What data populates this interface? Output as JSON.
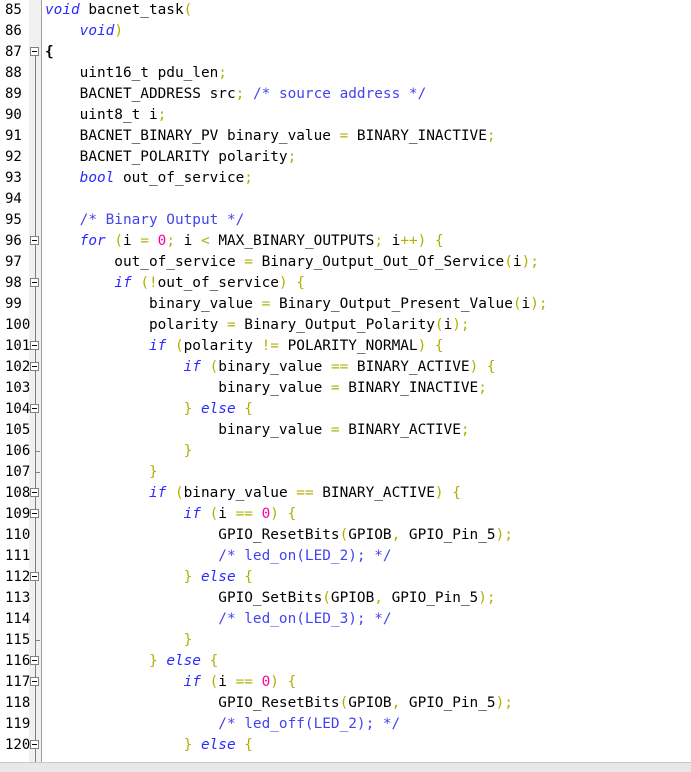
{
  "editor": {
    "lines": [
      {
        "n": "85",
        "fold": "",
        "html": "<span class='kw'>void</span> bacnet_task<span class='op'>(</span>"
      },
      {
        "n": "86",
        "fold": "",
        "html": "    <span class='kw'>void</span><span class='op'>)</span>"
      },
      {
        "n": "87",
        "fold": "box",
        "html": "<span class='br' style='color:#000;font-weight:bold'>{</span>"
      },
      {
        "n": "88",
        "fold": "",
        "html": "    uint16_t pdu_len<span class='op'>;</span>"
      },
      {
        "n": "89",
        "fold": "",
        "html": "    BACNET_ADDRESS src<span class='op'>;</span> <span class='cm'>/* source address */</span>"
      },
      {
        "n": "90",
        "fold": "",
        "html": "    uint8_t i<span class='op'>;</span>"
      },
      {
        "n": "91",
        "fold": "",
        "html": "    BACNET_BINARY_PV binary_value <span class='op'>=</span> BINARY_INACTIVE<span class='op'>;</span>"
      },
      {
        "n": "92",
        "fold": "",
        "html": "    BACNET_POLARITY polarity<span class='op'>;</span>"
      },
      {
        "n": "93",
        "fold": "",
        "html": "    <span class='kw'>bool</span> out_of_service<span class='op'>;</span>"
      },
      {
        "n": "94",
        "fold": "",
        "html": ""
      },
      {
        "n": "95",
        "fold": "",
        "html": "    <span class='cm'>/* Binary Output */</span>"
      },
      {
        "n": "96",
        "fold": "box",
        "html": "    <span class='kw'>for</span> <span class='op'>(</span>i <span class='op'>=</span> <span class='num'>0</span><span class='op'>;</span> i <span class='op'>&lt;</span> MAX_BINARY_OUTPUTS<span class='op'>;</span> i<span class='op'>++)</span> <span class='op'>{</span>"
      },
      {
        "n": "97",
        "fold": "",
        "html": "        out_of_service <span class='op'>=</span> Binary_Output_Out_Of_Service<span class='op'>(</span>i<span class='op'>);</span>"
      },
      {
        "n": "98",
        "fold": "box",
        "html": "        <span class='kw'>if</span> <span class='op'>(!</span>out_of_service<span class='op'>)</span> <span class='op'>{</span>"
      },
      {
        "n": "99",
        "fold": "",
        "html": "            binary_value <span class='op'>=</span> Binary_Output_Present_Value<span class='op'>(</span>i<span class='op'>);</span>"
      },
      {
        "n": "100",
        "fold": "",
        "html": "            polarity <span class='op'>=</span> Binary_Output_Polarity<span class='op'>(</span>i<span class='op'>);</span>"
      },
      {
        "n": "101",
        "fold": "box",
        "html": "            <span class='kw'>if</span> <span class='op'>(</span>polarity <span class='op'>!=</span> POLARITY_NORMAL<span class='op'>)</span> <span class='op'>{</span>"
      },
      {
        "n": "102",
        "fold": "box",
        "html": "                <span class='kw'>if</span> <span class='op'>(</span>binary_value <span class='op'>==</span> BINARY_ACTIVE<span class='op'>)</span> <span class='op'>{</span>"
      },
      {
        "n": "103",
        "fold": "",
        "html": "                    binary_value <span class='op'>=</span> BINARY_INACTIVE<span class='op'>;</span>"
      },
      {
        "n": "104",
        "fold": "box",
        "html": "                <span class='op'>}</span> <span class='kw'>else</span> <span class='op'>{</span>"
      },
      {
        "n": "105",
        "fold": "",
        "html": "                    binary_value <span class='op'>=</span> BINARY_ACTIVE<span class='op'>;</span>"
      },
      {
        "n": "106",
        "fold": "end",
        "html": "                <span class='op'>}</span>"
      },
      {
        "n": "107",
        "fold": "end",
        "html": "            <span class='op'>}</span>"
      },
      {
        "n": "108",
        "fold": "box",
        "html": "            <span class='kw'>if</span> <span class='op'>(</span>binary_value <span class='op'>==</span> BINARY_ACTIVE<span class='op'>)</span> <span class='op'>{</span>"
      },
      {
        "n": "109",
        "fold": "box",
        "html": "                <span class='kw'>if</span> <span class='op'>(</span>i <span class='op'>==</span> <span class='num'>0</span><span class='op'>)</span> <span class='op'>{</span>"
      },
      {
        "n": "110",
        "fold": "",
        "html": "                    GPIO_ResetBits<span class='op'>(</span>GPIOB<span class='op'>,</span> GPIO_Pin_5<span class='op'>);</span>"
      },
      {
        "n": "111",
        "fold": "",
        "html": "                    <span class='cm'>/* led_on(LED_2); */</span>"
      },
      {
        "n": "112",
        "fold": "box",
        "html": "                <span class='op'>}</span> <span class='kw'>else</span> <span class='op'>{</span>"
      },
      {
        "n": "113",
        "fold": "",
        "html": "                    GPIO_SetBits<span class='op'>(</span>GPIOB<span class='op'>,</span> GPIO_Pin_5<span class='op'>);</span>"
      },
      {
        "n": "114",
        "fold": "",
        "html": "                    <span class='cm'>/* led_on(LED_3); */</span>"
      },
      {
        "n": "115",
        "fold": "end",
        "html": "                <span class='op'>}</span>"
      },
      {
        "n": "116",
        "fold": "box",
        "html": "            <span class='op'>}</span> <span class='kw'>else</span> <span class='op'>{</span>"
      },
      {
        "n": "117",
        "fold": "box",
        "html": "                <span class='kw'>if</span> <span class='op'>(</span>i <span class='op'>==</span> <span class='num'>0</span><span class='op'>)</span> <span class='op'>{</span>"
      },
      {
        "n": "118",
        "fold": "",
        "html": "                    GPIO_ResetBits<span class='op'>(</span>GPIOB<span class='op'>,</span> GPIO_Pin_5<span class='op'>);</span>"
      },
      {
        "n": "119",
        "fold": "",
        "html": "                    <span class='cm'>/* led_off(LED_2); */</span>"
      },
      {
        "n": "120",
        "fold": "box",
        "html": "                <span class='op'>}</span> <span class='kw'>else</span> <span class='op'>{</span>"
      }
    ]
  },
  "colors": {
    "keyword": "#2b2bff",
    "comment": "#4444ee",
    "operator": "#b0b000",
    "number": "#ff00a0",
    "fold_margin": "#f0f0f0"
  }
}
